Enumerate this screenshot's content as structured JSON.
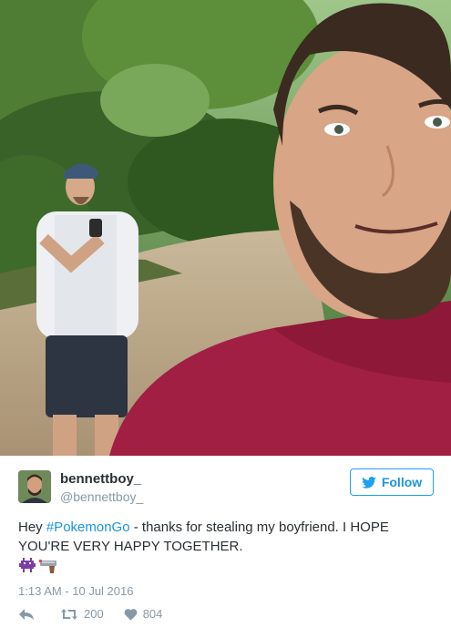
{
  "tweet": {
    "display_name": "bennettboy_",
    "handle": "@bennettboy_",
    "follow_label": "Follow",
    "text_before": "Hey ",
    "hashtag": "#PokemonGo",
    "text_after": " - thanks for stealing my boyfriend. I HOPE YOU'RE VERY HAPPY TOGETHER.",
    "emojis": [
      "alien-monster-emoji",
      "pistol-emoji"
    ],
    "timestamp": "1:13 AM - 10 Jul 2016",
    "retweet_count": "200",
    "like_count": "804",
    "icons": {
      "follow": "bird-icon",
      "reply": "reply-icon",
      "retweet": "retweet-icon",
      "like": "heart-icon"
    },
    "colors": {
      "accent": "#1da1f2",
      "link": "#1b95e0",
      "muted": "#8899a6",
      "text": "#292f33"
    }
  }
}
